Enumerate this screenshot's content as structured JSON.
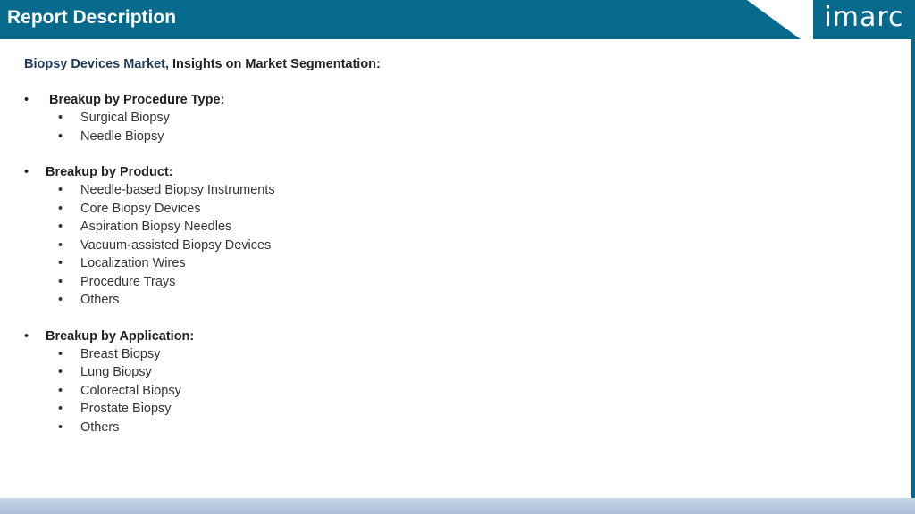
{
  "header": {
    "title": "Report Description",
    "logo": "imarc"
  },
  "subtitle": {
    "market": "Biopsy Devices Market,",
    "insight": " Insights on Market Segmentation:"
  },
  "sections": [
    {
      "heading": "Breakup by Procedure Type:",
      "items": [
        "Surgical Biopsy",
        "Needle Biopsy"
      ]
    },
    {
      "heading": "Breakup by Product:",
      "items": [
        "Needle-based Biopsy Instruments",
        "Core Biopsy Devices",
        "Aspiration Biopsy Needles",
        "Vacuum-assisted Biopsy Devices",
        "Localization Wires",
        "Procedure Trays",
        "Others"
      ]
    },
    {
      "heading": "Breakup by Application:",
      "items": [
        "Breast Biopsy",
        "Lung Biopsy",
        "Colorectal Biopsy",
        "Prostate Biopsy",
        "Others"
      ]
    }
  ],
  "bullet_glyph": "•",
  "colors": {
    "brand": "#066a8c",
    "footer": "#b9c9e0"
  }
}
